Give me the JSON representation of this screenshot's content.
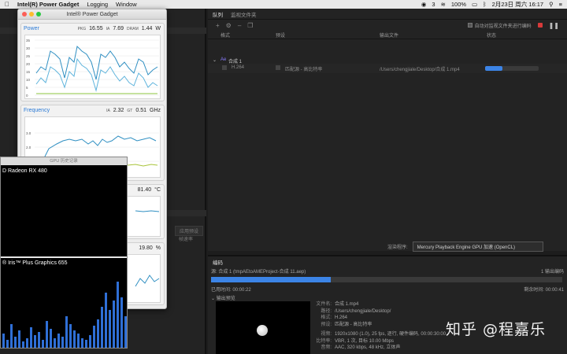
{
  "menubar": {
    "app_name": "Intel(R) Power Gadget",
    "menus": [
      "Logging",
      "Window"
    ],
    "status_icons": [
      "3",
      "100%"
    ],
    "datetime": "2月23日 周六  16:17"
  },
  "ame": {
    "tabs": [
      "队列",
      "监视文件夹"
    ],
    "toolbar": {
      "add_symbol": "+",
      "auto_encode_label": "自动对监视文件夹进行编码"
    },
    "columns": [
      "格式",
      "预设",
      "输出文件",
      "状态"
    ],
    "group_name": "合成 1",
    "queue_item": {
      "format": "H.264",
      "preset": "匹配源 - 高比特率",
      "output": "/Users/chengjiale/Desktop/合成 1.mp4",
      "progress": 0.33
    },
    "left_buttons": [
      "应用预设"
    ],
    "left_label": "帧速率",
    "renderer_label": "渲染程序:",
    "renderer_value": "Mercury Playback Engine GPU 加速 (OpenCL)",
    "encode": {
      "header": "编码",
      "source": "源: 合成 1 (tmpAEtoAMEProject-合成 11.aep)",
      "outputs": "1 输出编码",
      "elapsed": "已用时间: 00:00:22",
      "remaining": "剩余时间: 00:00:41",
      "progress": 0.34,
      "preview_label": "输出预览",
      "file_label": "文件名:",
      "file_value": "合成 1.mp4",
      "path_label": "路径:",
      "path_value": "/Users/chengjiale/Desktop/",
      "format_label": "格式:",
      "format_value": "H.264",
      "preset_label": "预设:",
      "preset_value": "匹配源 - 高比特率",
      "video_label": "视频:",
      "video_value": "1920x1080 (1.0), 25 fps, 逐行, 硬件编码, 00:00:30:00",
      "bitrate_label": "比特率:",
      "bitrate_value": "VBR, 1 次, 目标 10.00 Mbps",
      "audio_label": "音频:",
      "audio_value": "AAC, 320 kbps, 48 kHz, 立体声"
    }
  },
  "ipg": {
    "title": "Intel® Power Gadget",
    "power": {
      "title": "Power",
      "pkg_label": "PKG",
      "pkg": "16.55",
      "ia_label": "IA",
      "ia": "7.69",
      "dram_label": "DRAM",
      "dram": "1.44",
      "unit": "W",
      "y_ticks": [
        "35",
        "30",
        "25",
        "20",
        "15",
        "10",
        "5",
        "0"
      ]
    },
    "frequency": {
      "title": "Frequency",
      "ia_label": "IA",
      "ia": "2.32",
      "gt_label": "GT",
      "gt": "0.51",
      "unit": "GHz",
      "y_ticks": [
        "3.0",
        "2.0",
        "1.0"
      ]
    },
    "temperature": {
      "value": "81.40",
      "unit": "°C"
    },
    "utilization": {
      "value": "19.80",
      "unit": "%"
    }
  },
  "gpu": {
    "title": "GPU 历史记录",
    "gpu1": "D Radeon RX 480",
    "gpu2": "® Iris™ Plus Graphics 655"
  },
  "watermark": "知乎 @程嘉乐",
  "colors": {
    "accent_blue": "#3c84e6",
    "chart_blue": "#2f8fc2",
    "ipg_title_blue": "#2c7bd6"
  }
}
